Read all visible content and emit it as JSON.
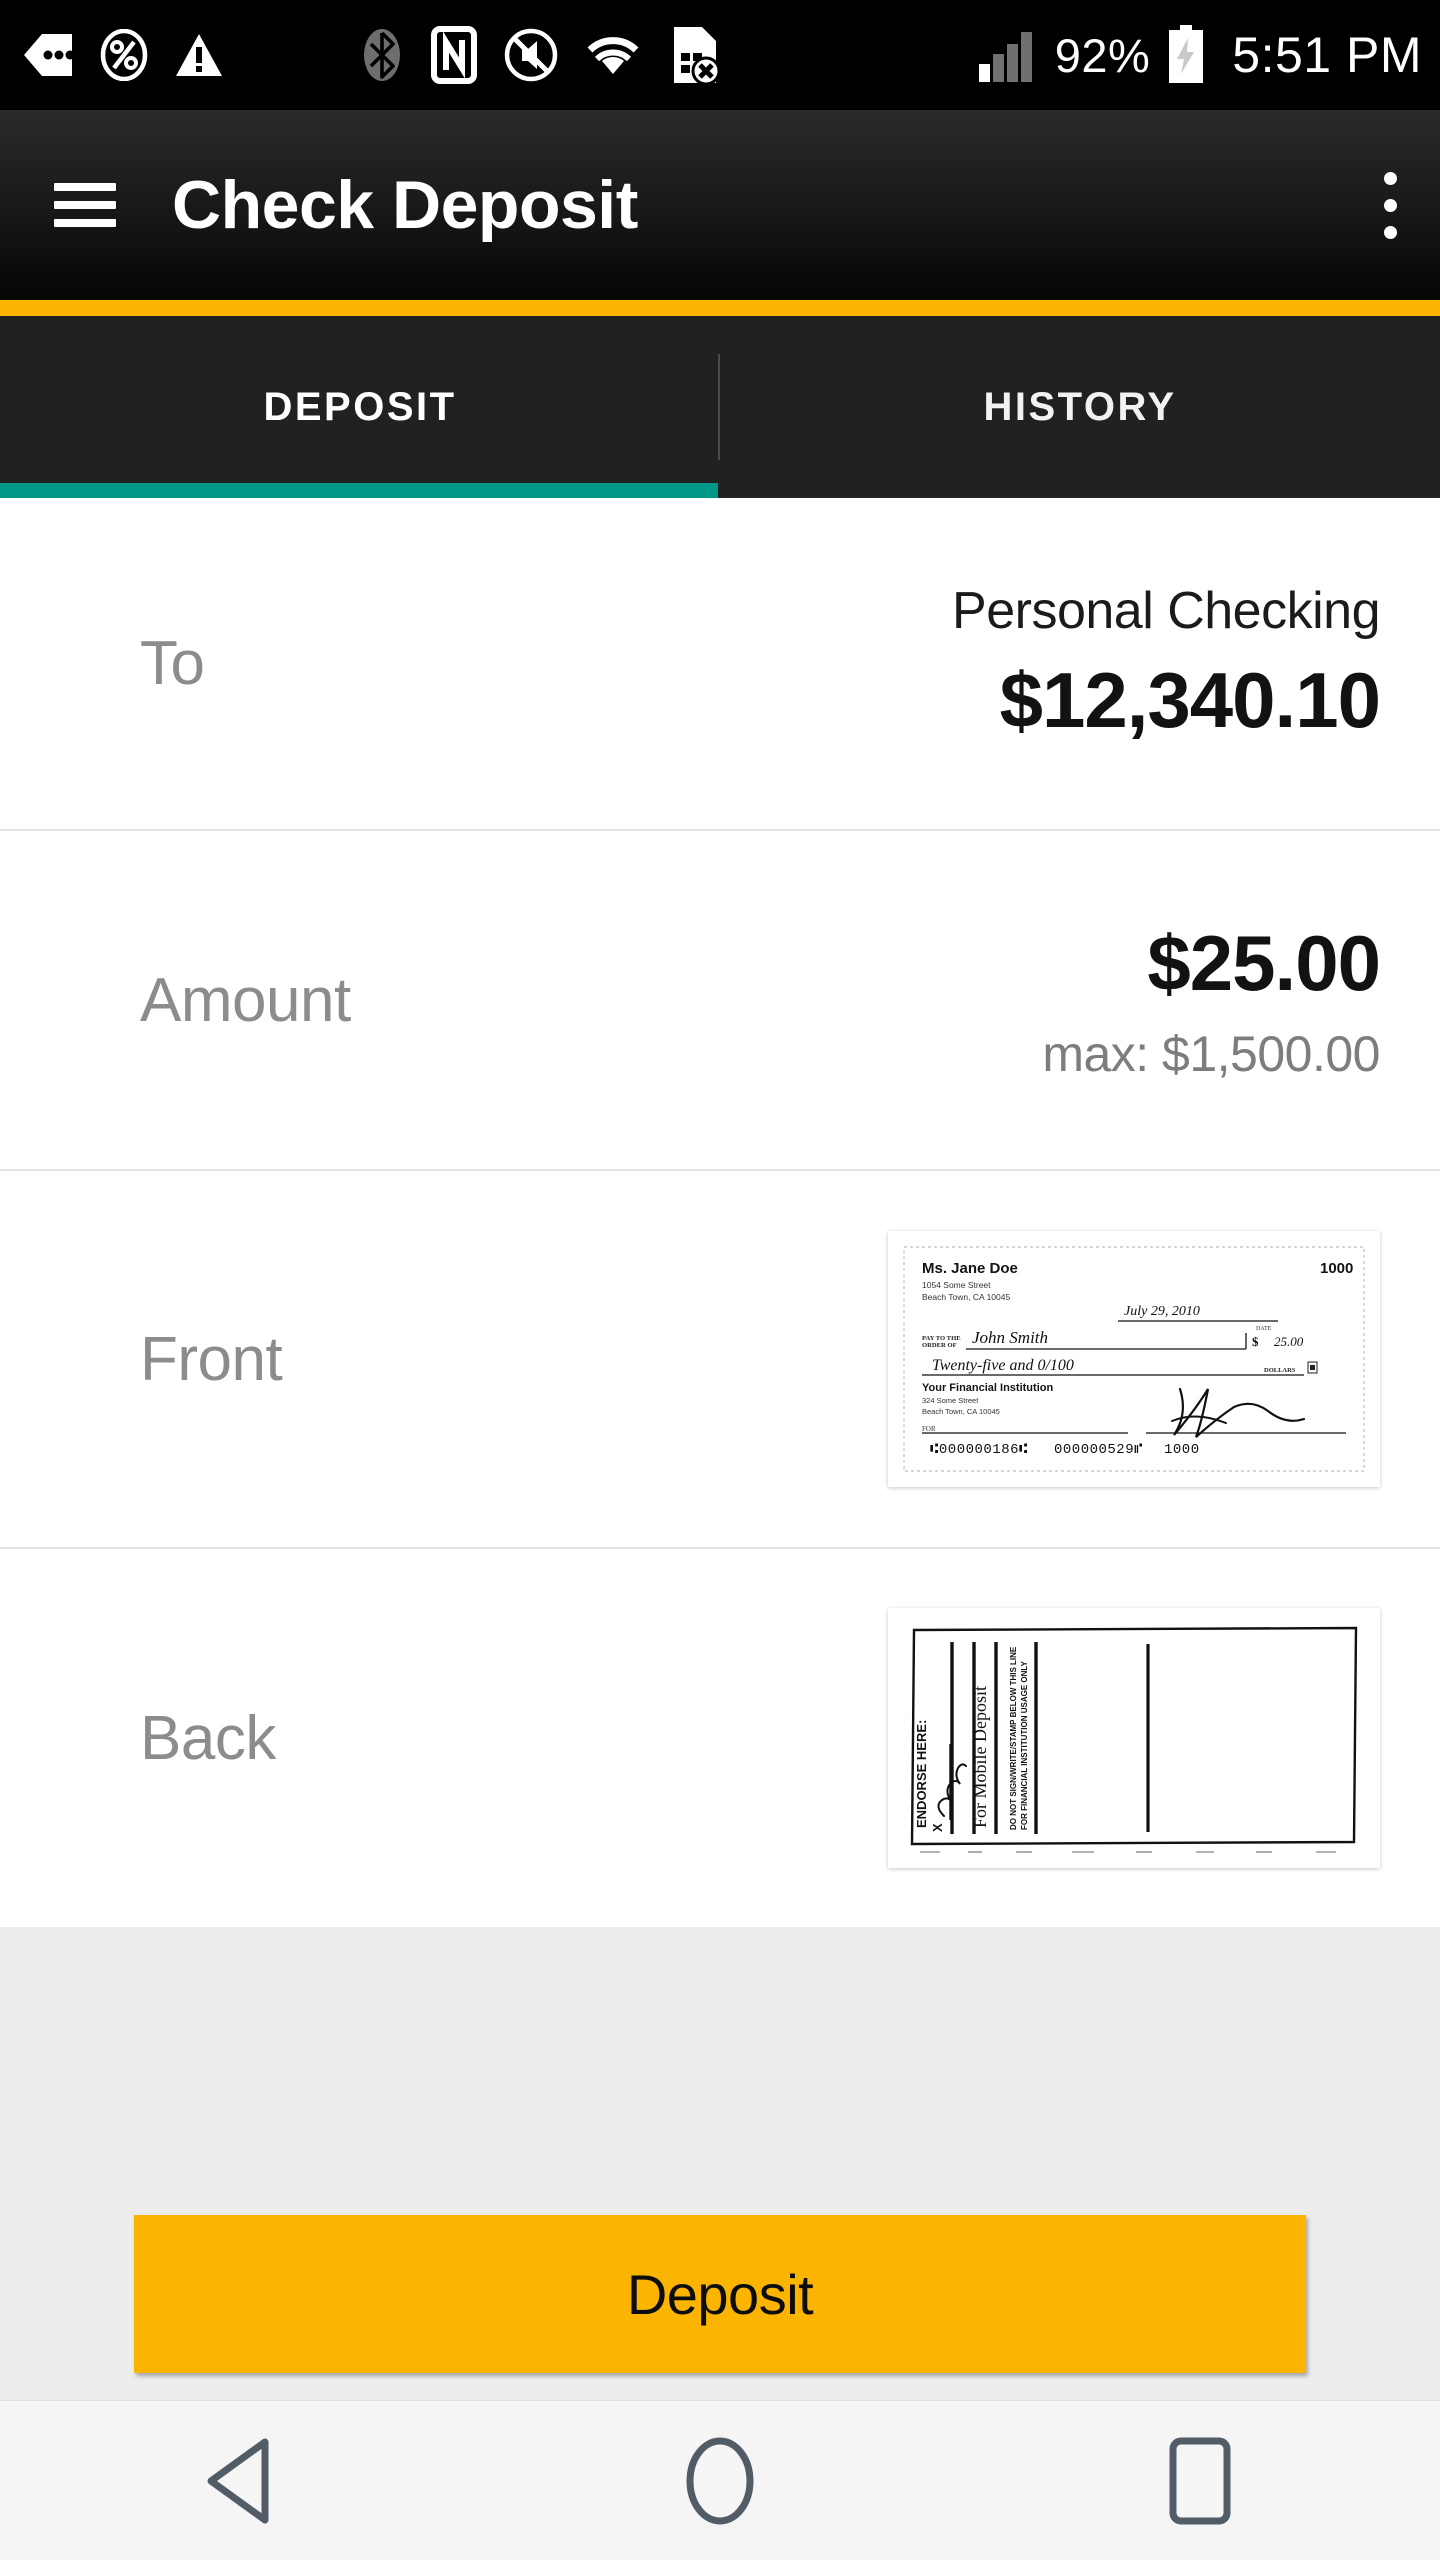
{
  "status_bar": {
    "icons": [
      "messaging-icon",
      "percent-circle-icon",
      "warning-triangle-icon",
      "bluetooth-icon",
      "nfc-icon",
      "mute-icon",
      "wifi-icon",
      "sim-card-error-icon",
      "signal-bars-icon"
    ],
    "battery_percent": "92%",
    "battery_icon": "battery-charging-icon",
    "time": "5:51 PM"
  },
  "app_bar": {
    "menu_icon": "hamburger-menu-icon",
    "title": "Check Deposit",
    "overflow_icon": "overflow-menu-icon",
    "accent_color": "#FBB500"
  },
  "tabs": {
    "active_index": 0,
    "indicator_color": "#009688",
    "items": [
      {
        "label": "DEPOSIT"
      },
      {
        "label": "HISTORY"
      }
    ]
  },
  "form": {
    "to": {
      "label": "To",
      "account_name": "Personal Checking",
      "account_balance": "$12,340.10"
    },
    "amount": {
      "label": "Amount",
      "value": "$25.00",
      "max_text": "max: $1,500.00"
    },
    "front": {
      "label": "Front",
      "image_name": "check-front-thumbnail"
    },
    "back": {
      "label": "Back",
      "image_name": "check-back-thumbnail"
    }
  },
  "check_front": {
    "payer_name": "Ms. Jane Doe",
    "payer_street": "1054 Some Street",
    "payer_city": "Beach Town, CA 10045",
    "check_number": "1000",
    "date": "July 29, 2010",
    "date_label": "DATE",
    "pay_to_label_line1": "PAY TO THE",
    "pay_to_label_line2": "ORDER OF",
    "payee": "John Smith",
    "amount_symbol": "$",
    "amount_numeric": "25.00",
    "amount_words": "Twenty-five and 0/100",
    "dollars_label": "DOLLARS",
    "bank_name": "Your Financial Institution",
    "bank_street": "324 Some Street",
    "bank_city": "Beach Town, CA 10045",
    "memo_label": "FOR",
    "micr_routing": "⑆000000186⑆",
    "micr_account": "000000529⑈",
    "micr_check_no": "1000"
  },
  "check_back": {
    "endorse_label": "ENDORSE HERE:",
    "x_mark": "X",
    "signature_text": "John Smith",
    "mobile_deposit_text": "For Mobile Deposit",
    "warning_line1": "DO NOT SIGN/WRITE/STAMP BELOW THIS LINE",
    "warning_line2": "FOR FINANCIAL INSTITUTION USAGE ONLY"
  },
  "footer": {
    "deposit_label": "Deposit",
    "button_color": "#FBB500"
  },
  "nav_bar": {
    "back_icon": "back-triangle-icon",
    "home_icon": "home-circle-icon",
    "recents_icon": "recents-square-icon"
  }
}
